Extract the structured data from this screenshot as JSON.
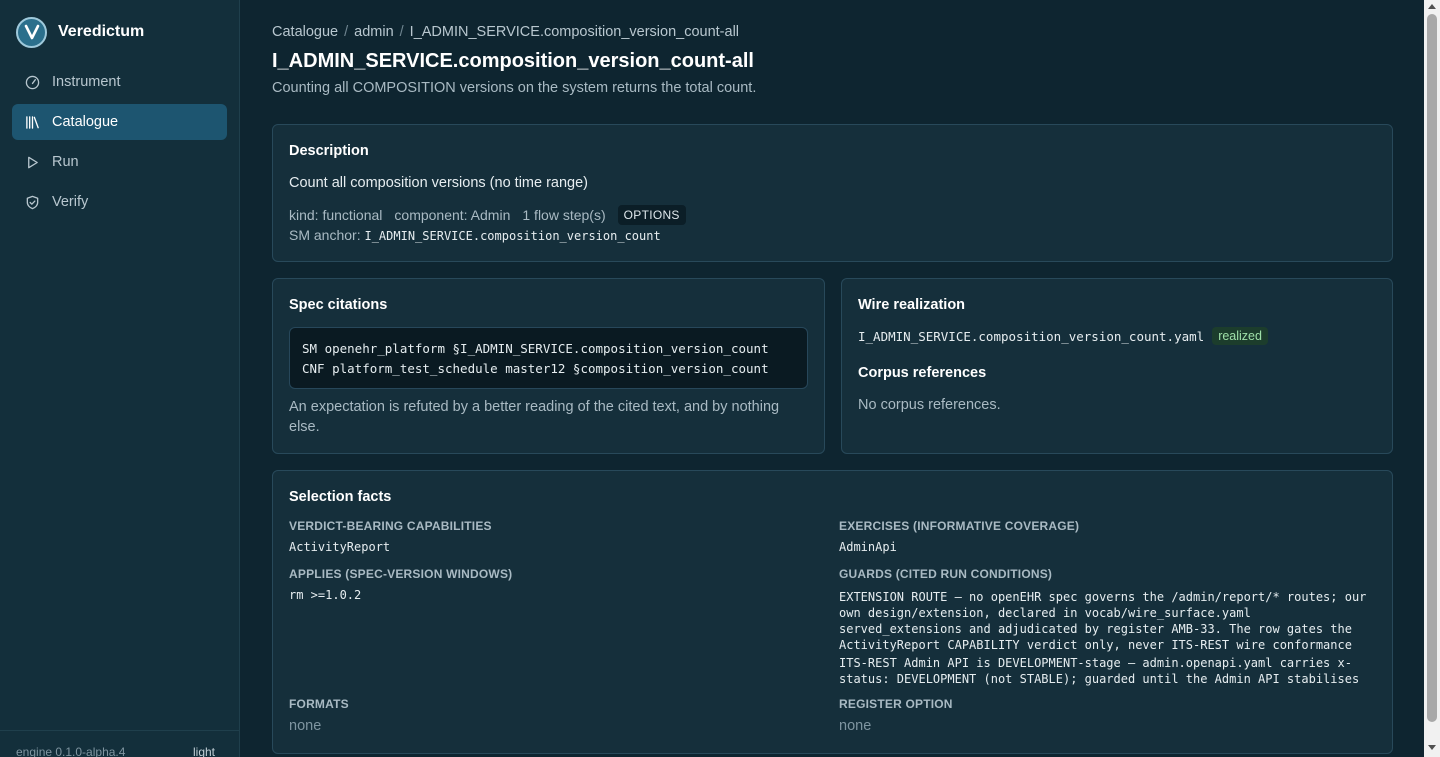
{
  "app": {
    "name": "Veredictum",
    "version": "engine 0.1.0-alpha.4",
    "theme_toggle": "light",
    "accent_color": "#1d5570"
  },
  "sidebar": {
    "items": [
      {
        "label": "Instrument",
        "icon": "gauge-icon",
        "active": false
      },
      {
        "label": "Catalogue",
        "icon": "library-icon",
        "active": true
      },
      {
        "label": "Run",
        "icon": "play-icon",
        "active": false
      },
      {
        "label": "Verify",
        "icon": "shield-check-icon",
        "active": false
      }
    ]
  },
  "breadcrumb": [
    "Catalogue",
    "admin",
    "I_ADMIN_SERVICE.composition_version_count-all"
  ],
  "header": {
    "title": "I_ADMIN_SERVICE.composition_version_count-all",
    "subtitle": "Counting all COMPOSITION versions on the system returns the total count."
  },
  "description": {
    "title": "Description",
    "text": "Count all composition versions (no time range)",
    "kind": "kind: functional",
    "component": "component: Admin",
    "flow_steps": "1 flow step(s)",
    "badge": "OPTIONS",
    "anchor_label": "SM anchor:",
    "anchor_value": "I_ADMIN_SERVICE.composition_version_count"
  },
  "spec_citations": {
    "title": "Spec citations",
    "lines": [
      "SM openehr_platform §I_ADMIN_SERVICE.composition_version_count",
      "CNF platform_test_schedule master12 §composition_version_count"
    ],
    "note": "An expectation is refuted by a better reading of the cited text, and by nothing else."
  },
  "wire_realization": {
    "title": "Wire realization",
    "file": "I_ADMIN_SERVICE.composition_version_count.yaml",
    "badge": "realized",
    "corpus_title": "Corpus references",
    "corpus_empty": "No corpus references."
  },
  "selection_facts": {
    "title": "Selection facts",
    "verdict_label": "VERDICT-BEARING CAPABILITIES",
    "verdict_value": "ActivityReport",
    "exercises_label": "EXERCISES (INFORMATIVE COVERAGE)",
    "exercises_value": "AdminApi",
    "applies_label": "APPLIES (SPEC-VERSION WINDOWS)",
    "applies_value": "rm >=1.0.2",
    "guards_label": "GUARDS (CITED RUN CONDITIONS)",
    "guards": [
      "EXTENSION ROUTE — no openEHR spec governs the /admin/report/* routes; our own design/extension, declared in vocab/wire_surface.yaml served_extensions and adjudicated by register AMB-33. The row gates the ActivityReport CAPABILITY verdict only, never ITS-REST wire conformance",
      "ITS-REST Admin API is DEVELOPMENT-stage — admin.openapi.yaml carries x-status: DEVELOPMENT (not STABLE); guarded until the Admin API stabilises"
    ],
    "formats_label": "FORMATS",
    "formats_value": "none",
    "register_label": "REGISTER OPTION",
    "register_value": "none"
  }
}
